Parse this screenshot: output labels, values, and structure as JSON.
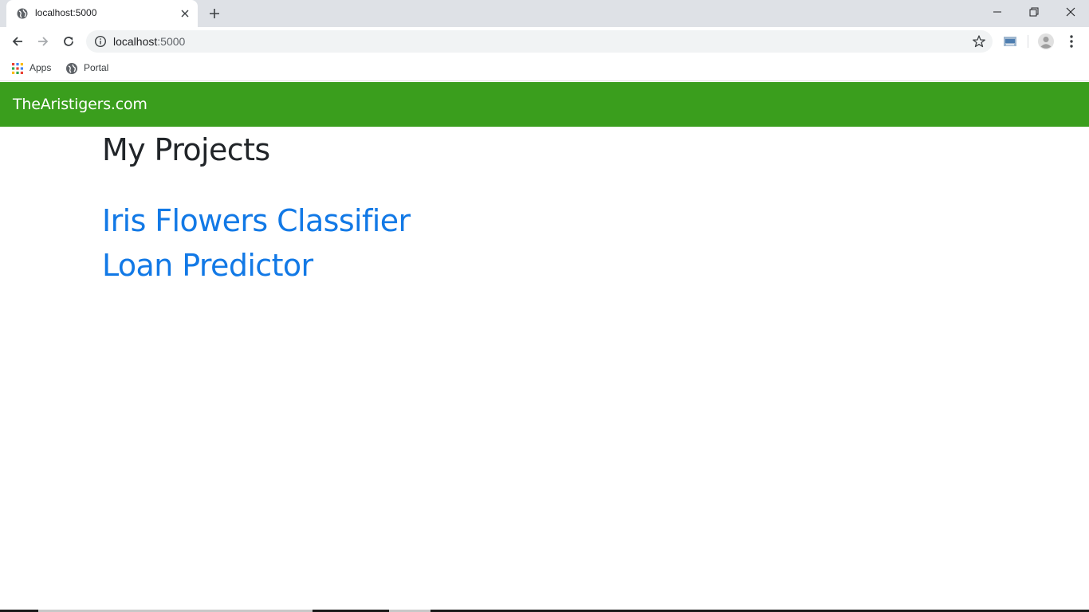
{
  "browser": {
    "tab": {
      "title": "localhost:5000"
    },
    "address": {
      "host": "localhost",
      "port": ":5000"
    },
    "bookmarks": [
      {
        "label": "Apps",
        "icon": "apps-grid-icon"
      },
      {
        "label": "Portal",
        "icon": "globe-icon"
      }
    ]
  },
  "navbar": {
    "brand": "TheAristigers.com",
    "color": "#3a9e1d"
  },
  "main": {
    "title": "My Projects",
    "projects": [
      {
        "label": "Iris Flowers Classifier"
      },
      {
        "label": "Loan Predictor"
      }
    ],
    "link_color": "#1279e6"
  }
}
